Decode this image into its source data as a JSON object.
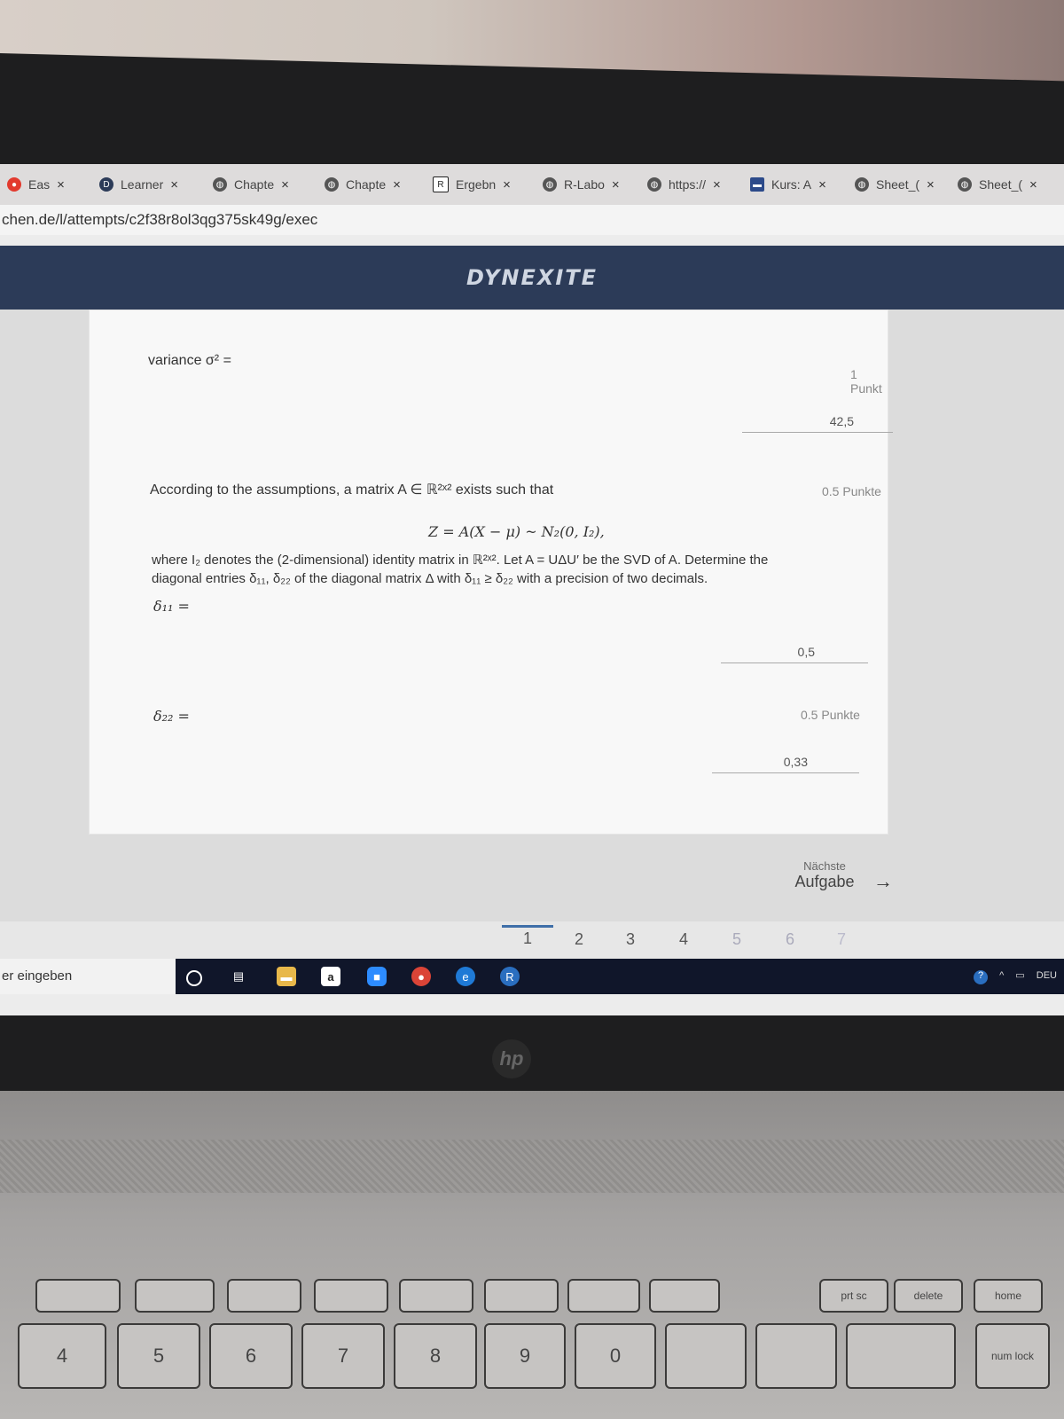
{
  "browser": {
    "tabs": [
      {
        "label": "Eas",
        "icon": "record-icon"
      },
      {
        "label": "Learner",
        "icon": "learner-icon"
      },
      {
        "label": "Chapte",
        "icon": "globe-icon"
      },
      {
        "label": "Chapte",
        "icon": "globe-icon"
      },
      {
        "label": "Ergebn",
        "icon": "r-icon"
      },
      {
        "label": "R-Labo",
        "icon": "globe-icon"
      },
      {
        "label": "https://",
        "icon": "globe-icon"
      },
      {
        "label": "Kurs: A",
        "icon": "kurs-icon"
      },
      {
        "label": "Sheet_(",
        "icon": "globe-icon"
      },
      {
        "label": "Sheet_(",
        "icon": "globe-icon"
      }
    ],
    "close_glyph": "×",
    "url": "chen.de/l/attempts/c2f38r8ol3qg375sk49g/exec"
  },
  "site": {
    "brand": "DYNEXITE"
  },
  "question": {
    "variance_label": "variance σ² =",
    "variance_points": "1 Punkt",
    "variance_answer": "42,5",
    "intro": "According to the assumptions, a matrix A ∈ ℝ²ˣ² exists such that",
    "formula": "Z = A(X − μ) ~ N₂(0, I₂),",
    "body_line1": "where I₂ denotes the (2-dimensional) identity matrix in ℝ²ˣ². Let A = UΔU′ be the SVD of A. Determine the",
    "body_line2": "diagonal entries δ₁₁, δ₂₂ of the diagonal matrix Δ with δ₁₁ ≥ δ₂₂ with a precision of two decimals.",
    "section_points": "0.5 Punkte",
    "d11_label": "δ₁₁ =",
    "d11_answer": "0,5",
    "d22_points": "0.5 Punkte",
    "d22_label": "δ₂₂ =",
    "d22_answer": "0,33"
  },
  "next": {
    "line1": "Nächste",
    "line2": "Aufgabe",
    "arrow": "→"
  },
  "pager": {
    "pages": [
      "1",
      "2",
      "3",
      "4",
      "5",
      "6",
      "7"
    ],
    "active": "1"
  },
  "taskbar": {
    "search_placeholder": "er eingeben",
    "icons": [
      "cortana-icon",
      "task-view-icon",
      "file-explorer-icon",
      "amazon-icon",
      "zoom-icon",
      "chrome-icon",
      "edge-icon",
      "r-icon"
    ],
    "tray_lang": "DEU"
  },
  "laptop": {
    "logo": "hp",
    "fkeys": [
      "",
      "",
      "",
      "",
      "",
      "",
      "",
      "",
      "prt sc",
      "delete",
      "home"
    ],
    "numkeys": [
      "4",
      "5",
      "6",
      "7",
      "8",
      "9",
      "0",
      "",
      "",
      "",
      "num lock"
    ]
  }
}
